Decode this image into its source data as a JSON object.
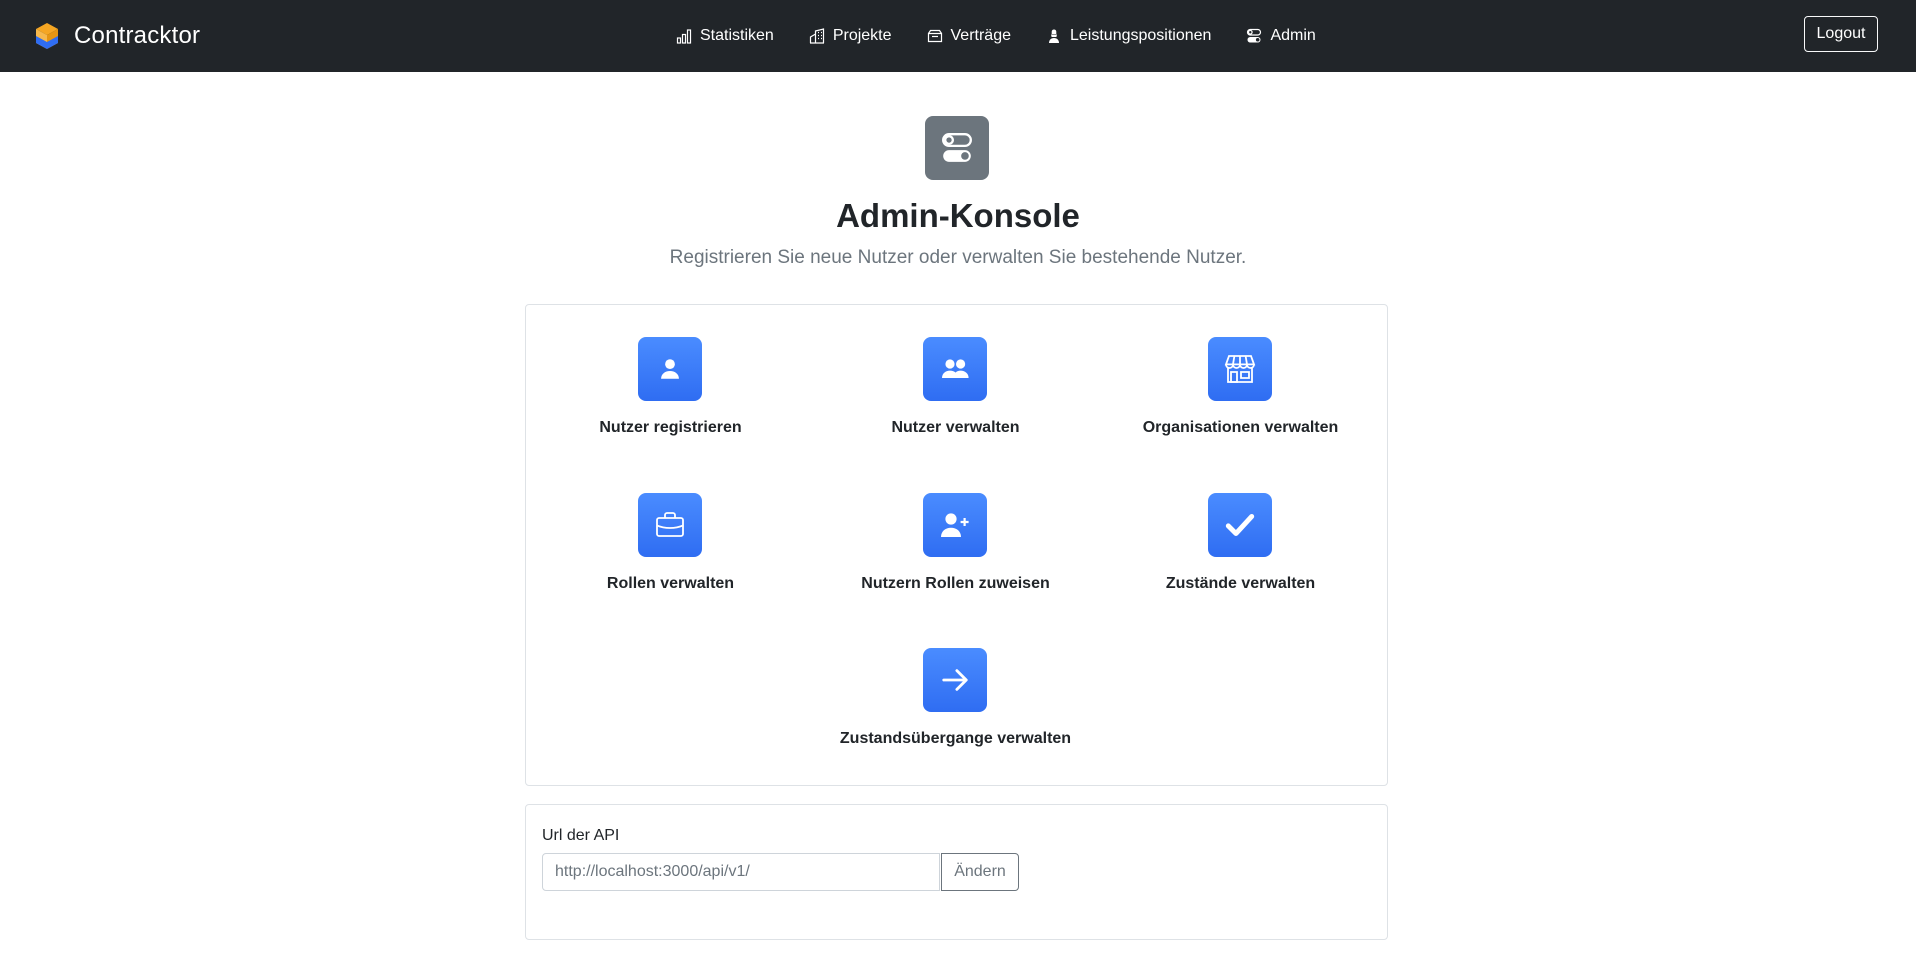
{
  "app": {
    "brand": "Contracktor",
    "brand_colors": {
      "top": "#f5a623",
      "bottom": "#2f6df2"
    }
  },
  "nav": {
    "items": [
      {
        "label": "Statistiken",
        "icon": "bar-chart-icon"
      },
      {
        "label": "Projekte",
        "icon": "buildings-icon"
      },
      {
        "label": "Verträge",
        "icon": "inbox-icon"
      },
      {
        "label": "Leistungspositionen",
        "icon": "worker-icon"
      },
      {
        "label": "Admin",
        "icon": "toggles-icon"
      }
    ],
    "logout_label": "Logout"
  },
  "header": {
    "icon": "toggles-icon",
    "title": "Admin-Konsole",
    "lead": "Registrieren Sie neue Nutzer oder verwalten Sie bestehende Nutzer."
  },
  "tiles": [
    {
      "label": "Nutzer registrieren",
      "icon": "person-icon"
    },
    {
      "label": "Nutzer verwalten",
      "icon": "people-icon"
    },
    {
      "label": "Organisationen verwalten",
      "icon": "shop-icon"
    },
    {
      "label": "Rollen verwalten",
      "icon": "briefcase-icon"
    },
    {
      "label": "Nutzern Rollen zuweisen",
      "icon": "person-plus-icon"
    },
    {
      "label": "Zustände verwalten",
      "icon": "check-icon"
    },
    {
      "label": "Zustandsübergange verwalten",
      "icon": "arrow-right-icon"
    }
  ],
  "api": {
    "label": "Url der API",
    "placeholder": "http://localhost:3000/api/v1/",
    "button_label": "Ändern"
  },
  "colors": {
    "navbar": "#212529",
    "accent": "#3b82f6",
    "secondary": "#6c757d"
  }
}
